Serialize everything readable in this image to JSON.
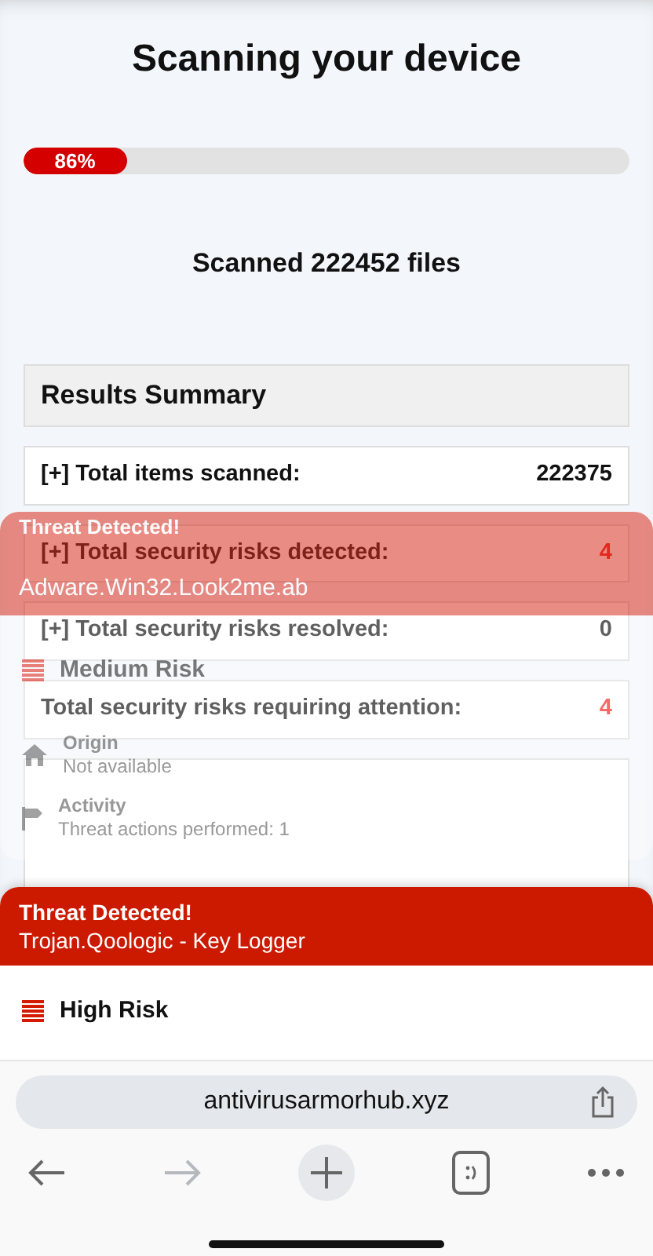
{
  "page": {
    "title": "Scanning your device",
    "progress": {
      "label": "86%",
      "level": 0.17
    },
    "scanned": "Scanned 222452 files"
  },
  "summary": {
    "title": "Results Summary",
    "rows": [
      {
        "label": "[+] Total items scanned:",
        "value": "222375",
        "alert": false
      },
      {
        "label": "[+] Total security risks detected:",
        "value": "4",
        "alert": true
      },
      {
        "label": "[+] Total security risks resolved:",
        "value": "0",
        "alert": false
      },
      {
        "label": "Total security risks requiring attention:",
        "value": "4",
        "alert": true
      }
    ]
  },
  "faded_alert": {
    "title": "Threat Detected!",
    "threat": "Adware.Win32.Look2me.ab",
    "risk": "Medium Risk",
    "details": [
      {
        "kind": "origin",
        "label": "Origin",
        "value": "Not available"
      },
      {
        "kind": "activity",
        "label": "Activity",
        "value": "Threat actions performed: 1"
      }
    ]
  },
  "alert": {
    "title": "Threat Detected!",
    "threat": "Trojan.Qoologic - Key Logger",
    "risk": "High Risk"
  },
  "browser": {
    "url": "antivirusarmorhub.xyz",
    "forward_disabled": true
  }
}
